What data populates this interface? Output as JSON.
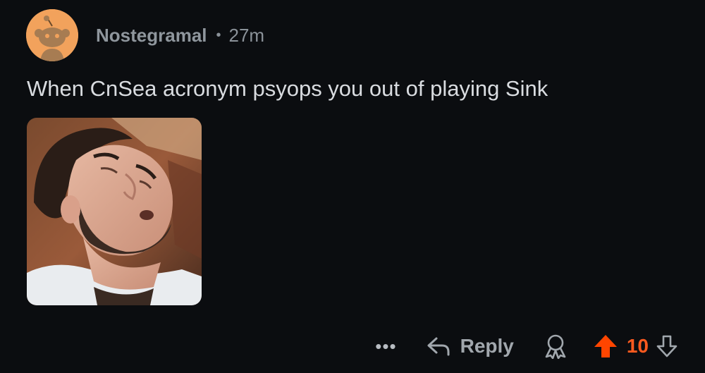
{
  "comment": {
    "author": "Nostegramal",
    "separator": "•",
    "time_ago": "27m",
    "body": "When CnSea acronym psyops you out of playing Sink"
  },
  "actions": {
    "more_label": "•••",
    "reply_label": "Reply",
    "score": "10"
  },
  "icons": {
    "avatar": "snoo-avatar-icon",
    "reply": "reply-arrow-icon",
    "award": "award-icon",
    "upvote": "upvote-arrow-icon",
    "downvote": "downvote-arrow-icon",
    "more": "more-options-icon"
  },
  "colors": {
    "background": "#0b0d10",
    "avatar_bg": "#f2a25c",
    "upvote_active": "#ff4500",
    "score": "#ff5a1f",
    "text": "#d9dce0",
    "muted": "#8b9299"
  }
}
